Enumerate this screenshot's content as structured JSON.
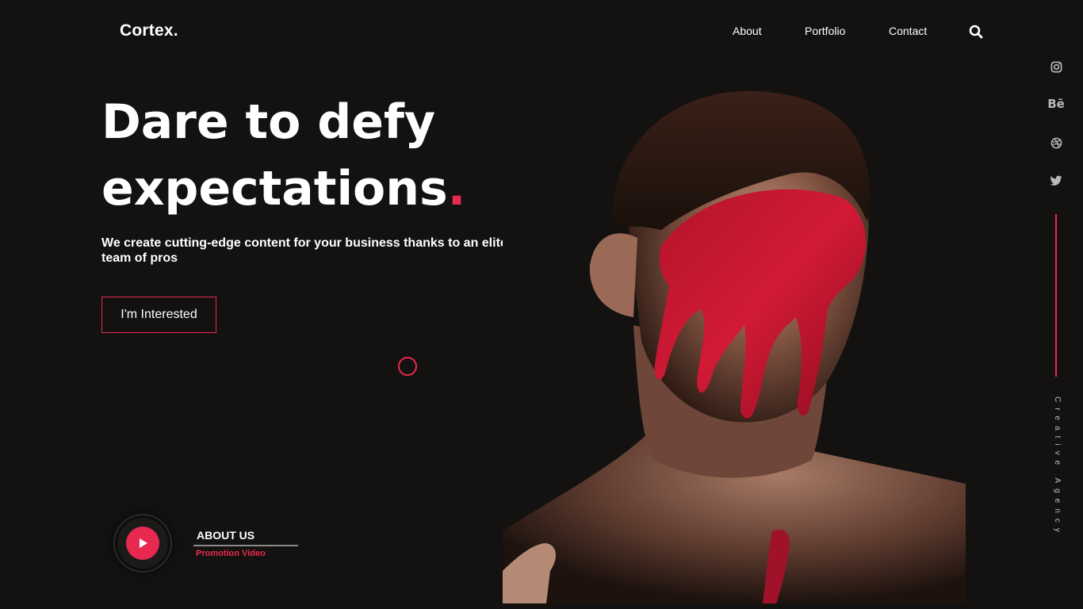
{
  "brand": {
    "logo": "Cortex."
  },
  "nav": {
    "items": [
      "About",
      "Portfolio",
      "Contact"
    ],
    "search_icon": "search-icon"
  },
  "hero": {
    "headline_line1": "Dare to defy",
    "headline_line2": "expectations",
    "headline_dot": ".",
    "subtitle": "We create cutting-edge content for your business thanks to an elite team of pros",
    "cta_label": "I'm Interested"
  },
  "video": {
    "title": "ABOUT US",
    "subtitle": "Promotion Video",
    "icon": "play-icon"
  },
  "social": {
    "icons": [
      "instagram-icon",
      "behance-icon",
      "dribbble-icon",
      "twitter-icon"
    ],
    "behance_text": "Bē"
  },
  "rail": {
    "vertical_text": "Creative   Agency"
  },
  "colors": {
    "background": "#131210",
    "accent": "#e8294f",
    "text": "#ffffff"
  }
}
